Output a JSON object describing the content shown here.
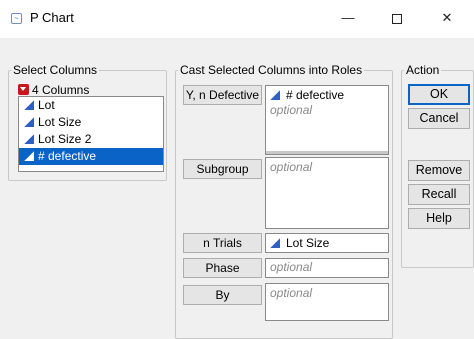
{
  "window": {
    "title": "P Chart",
    "minimize_glyph": "—",
    "close_glyph": "✕"
  },
  "select_columns": {
    "legend": "Select Columns",
    "count_label": "4 Columns",
    "columns": [
      {
        "label": "Lot",
        "icon": "continuous-icon",
        "selected": false
      },
      {
        "label": "Lot Size",
        "icon": "continuous-icon",
        "selected": false
      },
      {
        "label": "Lot Size 2",
        "icon": "continuous-icon",
        "selected": false
      },
      {
        "label": "# defective",
        "icon": "continuous-icon",
        "selected": true
      }
    ]
  },
  "cast_roles": {
    "legend": "Cast Selected Columns into Roles",
    "roles": {
      "y": {
        "button": "Y, n Defective",
        "value": "# defective",
        "placeholder": "optional"
      },
      "subgroup": {
        "button": "Subgroup",
        "placeholder": "optional"
      },
      "n_trials": {
        "button": "n Trials",
        "value": "Lot Size"
      },
      "phase": {
        "button": "Phase",
        "placeholder": "optional"
      },
      "by": {
        "button": "By",
        "placeholder": "optional"
      }
    }
  },
  "action": {
    "legend": "Action",
    "ok": "OK",
    "cancel": "Cancel",
    "remove": "Remove",
    "recall": "Recall",
    "help": "Help"
  },
  "colors": {
    "selection": "#0a63c7",
    "continuous_icon": "#2f5fc4",
    "dropdown_icon": "#c6171d"
  }
}
